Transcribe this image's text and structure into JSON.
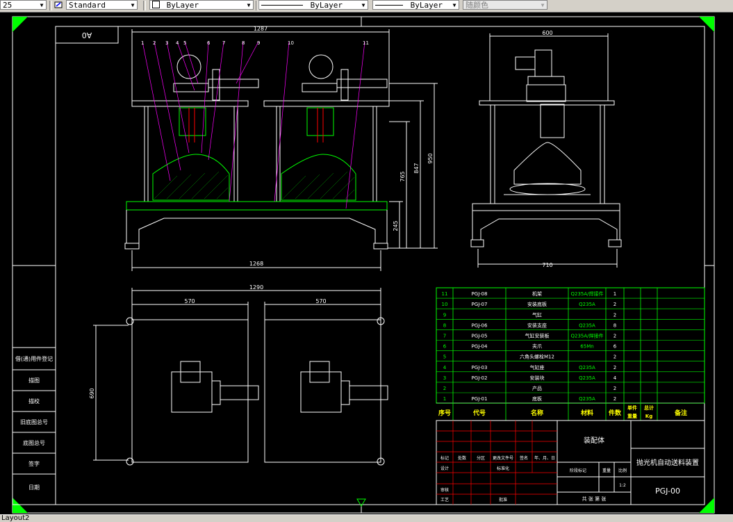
{
  "toolbar": {
    "scale_value": "25",
    "text_style": "Standard",
    "layer_color": "ByLayer",
    "linetype": "ByLayer",
    "lineweight": "ByLayer",
    "plot_style": "随颜色"
  },
  "status": {
    "layout_tab": "Layout2"
  },
  "drawing": {
    "sheet_code_rotated": "A0",
    "front_width": "1287",
    "front_base_width": "1268",
    "front_height_total": "950",
    "front_height_frame": "847",
    "front_height_table": "765",
    "front_height_leg": "245",
    "side_width_top": "600",
    "side_width_base": "710",
    "plan_width": "1290",
    "plan_half_left": "570",
    "plan_half_right": "570",
    "plan_depth": "690",
    "balloons": [
      "1",
      "2",
      "3",
      "4",
      "5",
      "6",
      "7",
      "8",
      "9",
      "10",
      "11"
    ]
  },
  "bom": {
    "rows": [
      {
        "no": "11",
        "code": "PGJ-08",
        "name": "机架",
        "material": "Q235A/焊接件",
        "qty": "1"
      },
      {
        "no": "10",
        "code": "PGJ-07",
        "name": "安装底板",
        "material": "Q235A",
        "qty": "2"
      },
      {
        "no": "9",
        "code": "",
        "name": "气缸",
        "material": "",
        "qty": "2"
      },
      {
        "no": "8",
        "code": "PGJ-06",
        "name": "安装支座",
        "material": "Q235A",
        "qty": "8"
      },
      {
        "no": "7",
        "code": "PGJ-05",
        "name": "气缸安装板",
        "material": "Q235A/焊接件",
        "qty": "2"
      },
      {
        "no": "6",
        "code": "PGJ-04",
        "name": "夹爪",
        "material": "65Mn",
        "qty": "6"
      },
      {
        "no": "5",
        "code": "",
        "name": "六角头螺栓M12",
        "material": "",
        "qty": "2"
      },
      {
        "no": "4",
        "code": "PGJ-03",
        "name": "气缸座",
        "material": "Q235A",
        "qty": "2"
      },
      {
        "no": "3",
        "code": "PGJ-02",
        "name": "安装块",
        "material": "Q235A",
        "qty": "4"
      },
      {
        "no": "2",
        "code": "",
        "name": "产品",
        "material": "",
        "qty": "2"
      },
      {
        "no": "1",
        "code": "PGJ-01",
        "name": "底板",
        "material": "Q235A",
        "qty": "2"
      }
    ],
    "header": {
      "no": "序号",
      "code": "代号",
      "name": "名称",
      "material": "材料",
      "qty": "件数",
      "unit_weight": "单件",
      "total_weight": "总计",
      "weight": "重量",
      "weight_unit": "Kg",
      "remark": "备注"
    }
  },
  "title_block": {
    "assembly": "装配体",
    "drawing_title": "抛光机自动送料装置",
    "drawing_no": "PGJ-00",
    "scale": "1:2",
    "scale_label": "比例",
    "mass_label": "重量",
    "stage_label": "阶段标记",
    "sheets": "共  张  第  张",
    "row_labels": [
      "标记",
      "处数",
      "分区",
      "更改文件号",
      "签名",
      "年、月、日"
    ],
    "design": "设计",
    "standard": "标准化",
    "check": "审核",
    "process": "工艺",
    "approve": "批准"
  },
  "left_strip": [
    "借(通)用件登记",
    "描图",
    "描校",
    "旧底图总号",
    "底图总号",
    "签字",
    "日期"
  ],
  "colors": {
    "line": "#ffffff",
    "green": "#00ff00",
    "magenta": "#ff00ff",
    "red": "#ff0000",
    "cyan": "#00ffff",
    "yellow": "#ffff00",
    "gray": "#808080"
  }
}
